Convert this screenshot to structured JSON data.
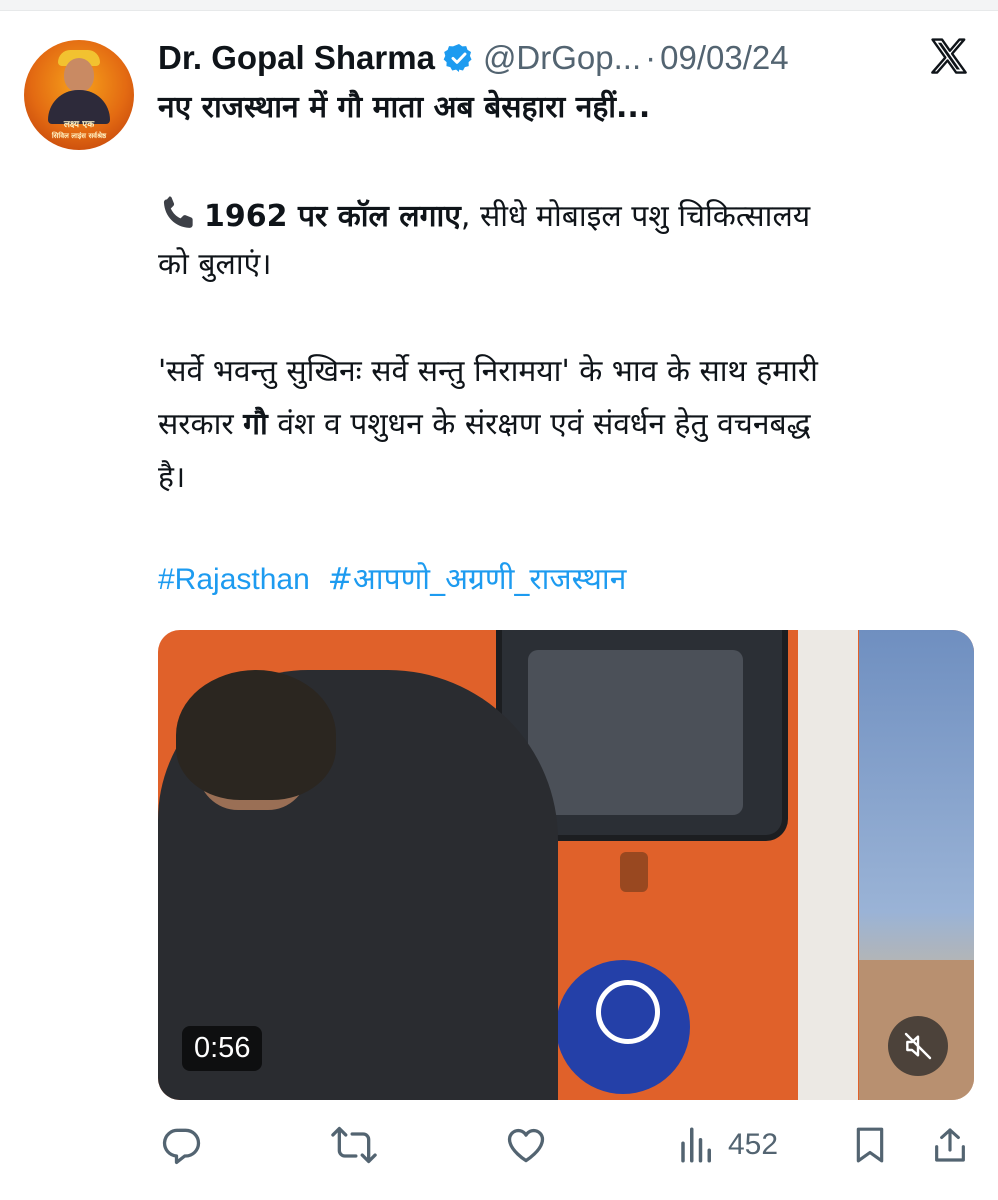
{
  "tweet": {
    "author_name": "Dr. Gopal Sharma",
    "handle": "@DrGop...",
    "separator": "·",
    "date": "09/03/24",
    "avatar_text_1": "लक्ष्य एक",
    "avatar_text_2": "सिविल लाइंस सर्वश्रेष्ठ",
    "headline": "नए राजस्थान में गौ माता अब बेसहारा नहीं...",
    "call_bold": "1962 पर कॉल लगाए",
    "call_rest": ", सीधे मोबाइल पशु चिकित्सालय",
    "call_line2": "को बुलाएं।",
    "para_line1": "'सर्वे भवन्तु सुखिनः सर्वे सन्तु निरामया' के भाव के साथ हमारी",
    "para_line2_a": "सरकार ",
    "para_line2_bold": "गौ",
    "para_line2_b": " वंश व पशुधन के संरक्षण एवं संवर्धन हेतु वचनबद्ध",
    "para_line3": "है।",
    "hashtags": [
      "#Rajasthan",
      "#आपणो_अग्रणी_राजस्थान"
    ]
  },
  "video": {
    "duration": "0:56",
    "muted": true
  },
  "actions": {
    "views": "452",
    "icons": [
      "reply-icon",
      "retweet-icon",
      "like-icon",
      "views-icon",
      "bookmark-icon",
      "share-icon"
    ]
  },
  "colors": {
    "link": "#1d9bf0",
    "muted_text": "#536471",
    "verified": "#1d9bf0"
  }
}
